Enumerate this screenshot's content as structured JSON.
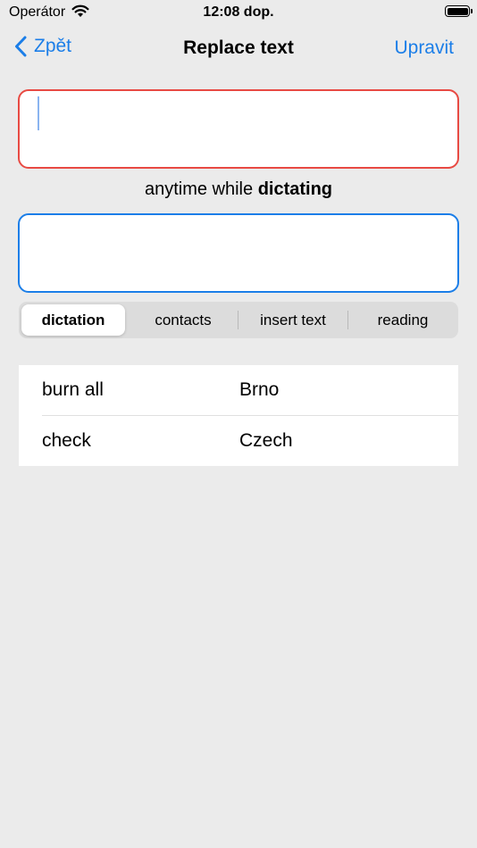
{
  "status_bar": {
    "carrier": "Operátor",
    "time": "12:08 dop."
  },
  "nav": {
    "back_label": "Zpět",
    "title": "Replace text",
    "edit_label": "Upravit"
  },
  "search_field": {
    "value": "",
    "placeholder": ""
  },
  "replace_field": {
    "value": "",
    "placeholder": ""
  },
  "mode_caption": {
    "prefix": "anytime while",
    "bold": "dictating"
  },
  "segments": [
    {
      "label": "dictation",
      "selected": true
    },
    {
      "label": "contacts",
      "selected": false
    },
    {
      "label": "insert text",
      "selected": false
    },
    {
      "label": "reading",
      "selected": false
    }
  ],
  "replacements": [
    {
      "from": "burn all",
      "to": "Brno"
    },
    {
      "from": "check",
      "to": "Czech"
    }
  ],
  "colors": {
    "accent": "#1b7ee8",
    "search_border": "#e84a43",
    "background": "#ebebeb"
  }
}
